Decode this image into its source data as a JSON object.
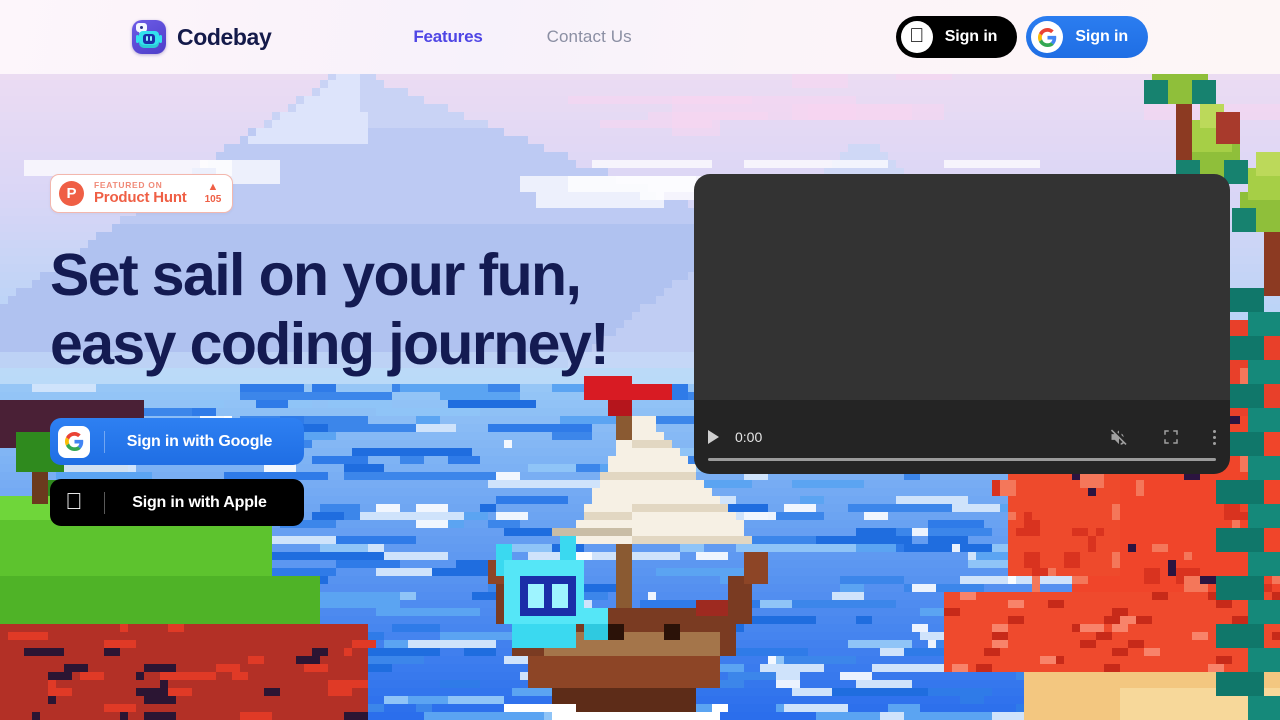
{
  "header": {
    "brand": {
      "name": "Codebay",
      "logo_icon": "codebay-robot-logo",
      "logo_bg": "#5b4bd6",
      "robot_color": "#33e1ee"
    },
    "nav": [
      {
        "label": "Features",
        "active": true,
        "color": "#4f46e5"
      },
      {
        "label": "Contact Us",
        "active": false,
        "color": "#8b8fa3"
      }
    ],
    "actions": [
      {
        "id": "apple-signin",
        "label": "Sign in",
        "icon": "apple-icon",
        "bg": "#000000"
      },
      {
        "id": "google-signin",
        "label": "Sign in",
        "icon": "google-icon",
        "bg": "#1f6ee4"
      }
    ]
  },
  "hero": {
    "badge": {
      "logo_letter": "P",
      "eyebrow": "FEATURED ON",
      "name": "Product Hunt",
      "vote_arrow": "▲",
      "vote_count": "105",
      "accent": "#ef5f45"
    },
    "headline_line1": "Set sail on your fun,",
    "headline_line2": "easy coding journey!",
    "headline_color": "#141b52",
    "cta": [
      {
        "id": "google-cta",
        "label": "Sign in with Google",
        "icon": "google-icon",
        "bg": "#1f6ee4"
      },
      {
        "id": "apple-cta",
        "label": "Sign in with Apple",
        "icon": "apple-icon",
        "bg": "#000000"
      }
    ]
  },
  "video": {
    "time": "0:00",
    "bg": "#333333",
    "controls": {
      "play_icon": "play-icon",
      "volume_icon": "volume-muted-icon",
      "fullscreen_icon": "fullscreen-icon",
      "menu_icon": "kebab-menu-icon"
    }
  },
  "scene": {
    "description": "pixel-art seascape with sailing ship",
    "sky_top": "#f6dff0",
    "sky_bottom": "#a9d2f7",
    "mountain": "#b9c6f2",
    "water": "#2f7be8",
    "grass": "#5dc32e",
    "cliff": "#f0452a",
    "sand": "#f3c780",
    "ship_hull": "#7a3b22",
    "sail": "#f6f0e4",
    "flag": "#d81b23",
    "robot": "#3ad9f0"
  }
}
